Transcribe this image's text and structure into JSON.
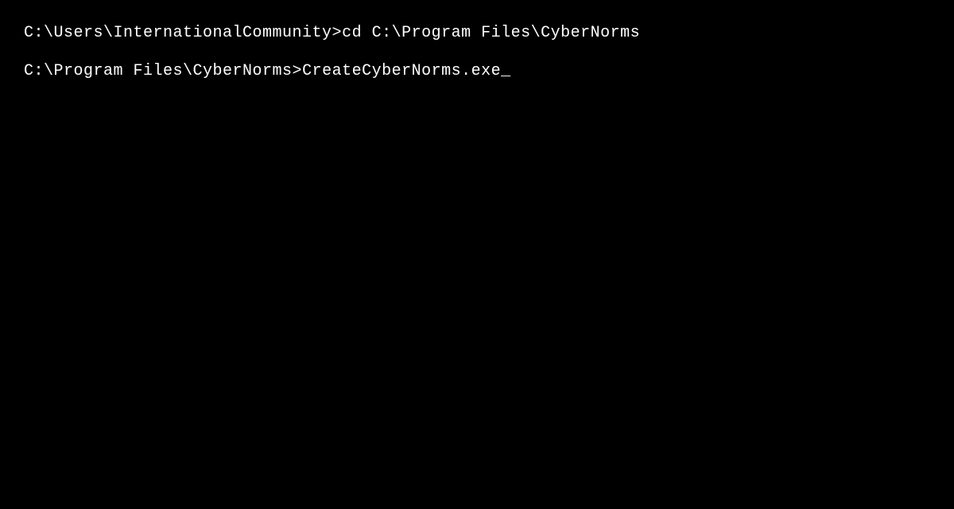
{
  "terminal": {
    "lines": [
      {
        "prompt": "C:\\Users\\InternationalCommunity>",
        "command": "cd C:\\Program Files\\CyberNorms"
      },
      {
        "prompt": "C:\\Program Files\\CyberNorms>",
        "command": "CreateCyberNorms.exe"
      }
    ],
    "cursor": "_"
  }
}
